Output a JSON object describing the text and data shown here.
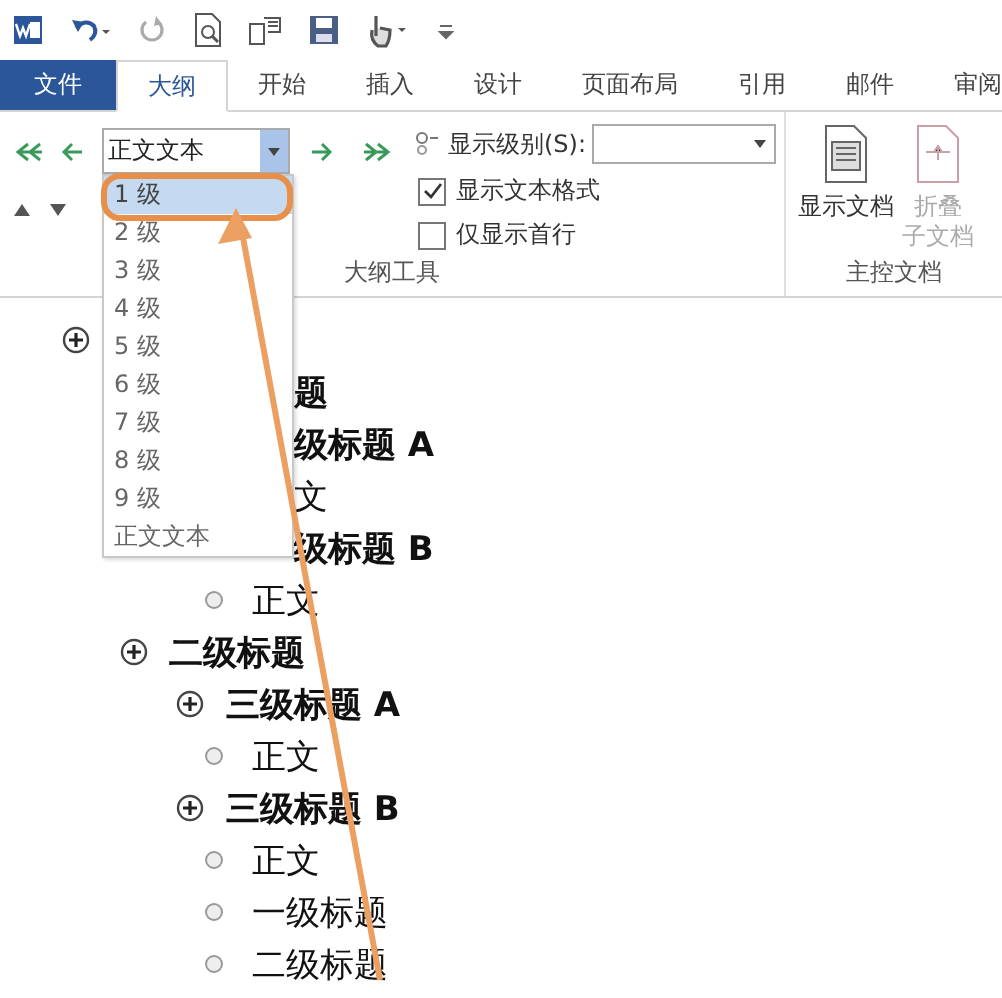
{
  "tabs": [
    {
      "label": "文件",
      "kind": "file",
      "selected": false
    },
    {
      "label": "大纲",
      "kind": "tab",
      "selected": true
    },
    {
      "label": "开始",
      "kind": "tab",
      "selected": false
    },
    {
      "label": "插入",
      "kind": "tab",
      "selected": false
    },
    {
      "label": "设计",
      "kind": "tab",
      "selected": false
    },
    {
      "label": "页面布局",
      "kind": "tab",
      "selected": false
    },
    {
      "label": "引用",
      "kind": "tab",
      "selected": false
    },
    {
      "label": "邮件",
      "kind": "tab",
      "selected": false
    },
    {
      "label": "审阅",
      "kind": "tab",
      "selected": false
    }
  ],
  "outline_tools": {
    "level_box": {
      "value": "正文文本",
      "expanded": true
    },
    "level_menu": [
      {
        "label": "1 级",
        "selected": true
      },
      {
        "label": "2 级",
        "selected": false
      },
      {
        "label": "3 级",
        "selected": false
      },
      {
        "label": "4 级",
        "selected": false
      },
      {
        "label": "5 级",
        "selected": false
      },
      {
        "label": "6 级",
        "selected": false
      },
      {
        "label": "7 级",
        "selected": false
      },
      {
        "label": "8 级",
        "selected": false
      },
      {
        "label": "9 级",
        "selected": false
      },
      {
        "label": "正文文本",
        "selected": false
      }
    ],
    "show_level": {
      "label": "显示级别(S):"
    },
    "checkboxes": [
      {
        "label": "显示文本格式",
        "checked": true
      },
      {
        "label": "仅显示首行",
        "checked": false
      }
    ],
    "group_label": "大纲工具"
  },
  "master_document": {
    "buttons": [
      {
        "lines": [
          "显示文档"
        ],
        "disabled": false
      },
      {
        "lines": [
          "折叠",
          "子文档"
        ],
        "disabled": true
      }
    ],
    "group_label": "主控文档"
  },
  "outline": [
    {
      "kind": "heading",
      "covered": true,
      "children": [
        {
          "kind": "heading",
          "text": "题",
          "covered": true,
          "children": [
            {
              "kind": "heading",
              "text": "级标题 A",
              "covered": true,
              "children": [
                {
                  "kind": "body",
                  "text": "文",
                  "covered": true
                }
              ]
            },
            {
              "kind": "heading",
              "text": "级标题 B",
              "covered": true,
              "children": [
                {
                  "kind": "body",
                  "text": "正文",
                  "covered": false
                }
              ]
            }
          ]
        },
        {
          "kind": "heading",
          "text": "二级标题",
          "covered": false,
          "children": [
            {
              "kind": "heading",
              "text": "三级标题 A",
              "covered": false,
              "children": [
                {
                  "kind": "body",
                  "text": "正文",
                  "covered": false
                }
              ]
            },
            {
              "kind": "heading",
              "text": "三级标题 B",
              "covered": false,
              "children": [
                {
                  "kind": "body",
                  "text": "正文",
                  "covered": false
                },
                {
                  "kind": "body",
                  "text": "一级标题",
                  "covered": false
                },
                {
                  "kind": "body",
                  "text": "二级标题",
                  "covered": false
                }
              ]
            }
          ]
        }
      ]
    }
  ]
}
